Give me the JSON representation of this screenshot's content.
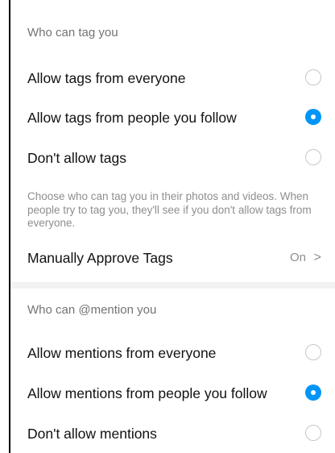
{
  "tags_section": {
    "header": "Who can tag you",
    "options": [
      {
        "label": "Allow tags from everyone",
        "selected": false
      },
      {
        "label": "Allow tags from people you follow",
        "selected": true
      },
      {
        "label": "Don't allow tags",
        "selected": false
      }
    ],
    "description": "Choose who can tag you in their photos and videos. When people try to tag you, they'll see if you don't allow tags from everyone.",
    "manual_approve": {
      "label": "Manually Approve Tags",
      "value": "On",
      "chevron": ">"
    }
  },
  "mentions_section": {
    "header": "Who can @mention you",
    "options": [
      {
        "label": "Allow mentions from everyone",
        "selected": false
      },
      {
        "label": "Allow mentions from people you follow",
        "selected": true
      },
      {
        "label": "Don't allow mentions",
        "selected": false
      }
    ]
  },
  "colors": {
    "accent": "#0095f6",
    "secondary_text": "#737373",
    "section_divider": "#f2f2f2"
  }
}
